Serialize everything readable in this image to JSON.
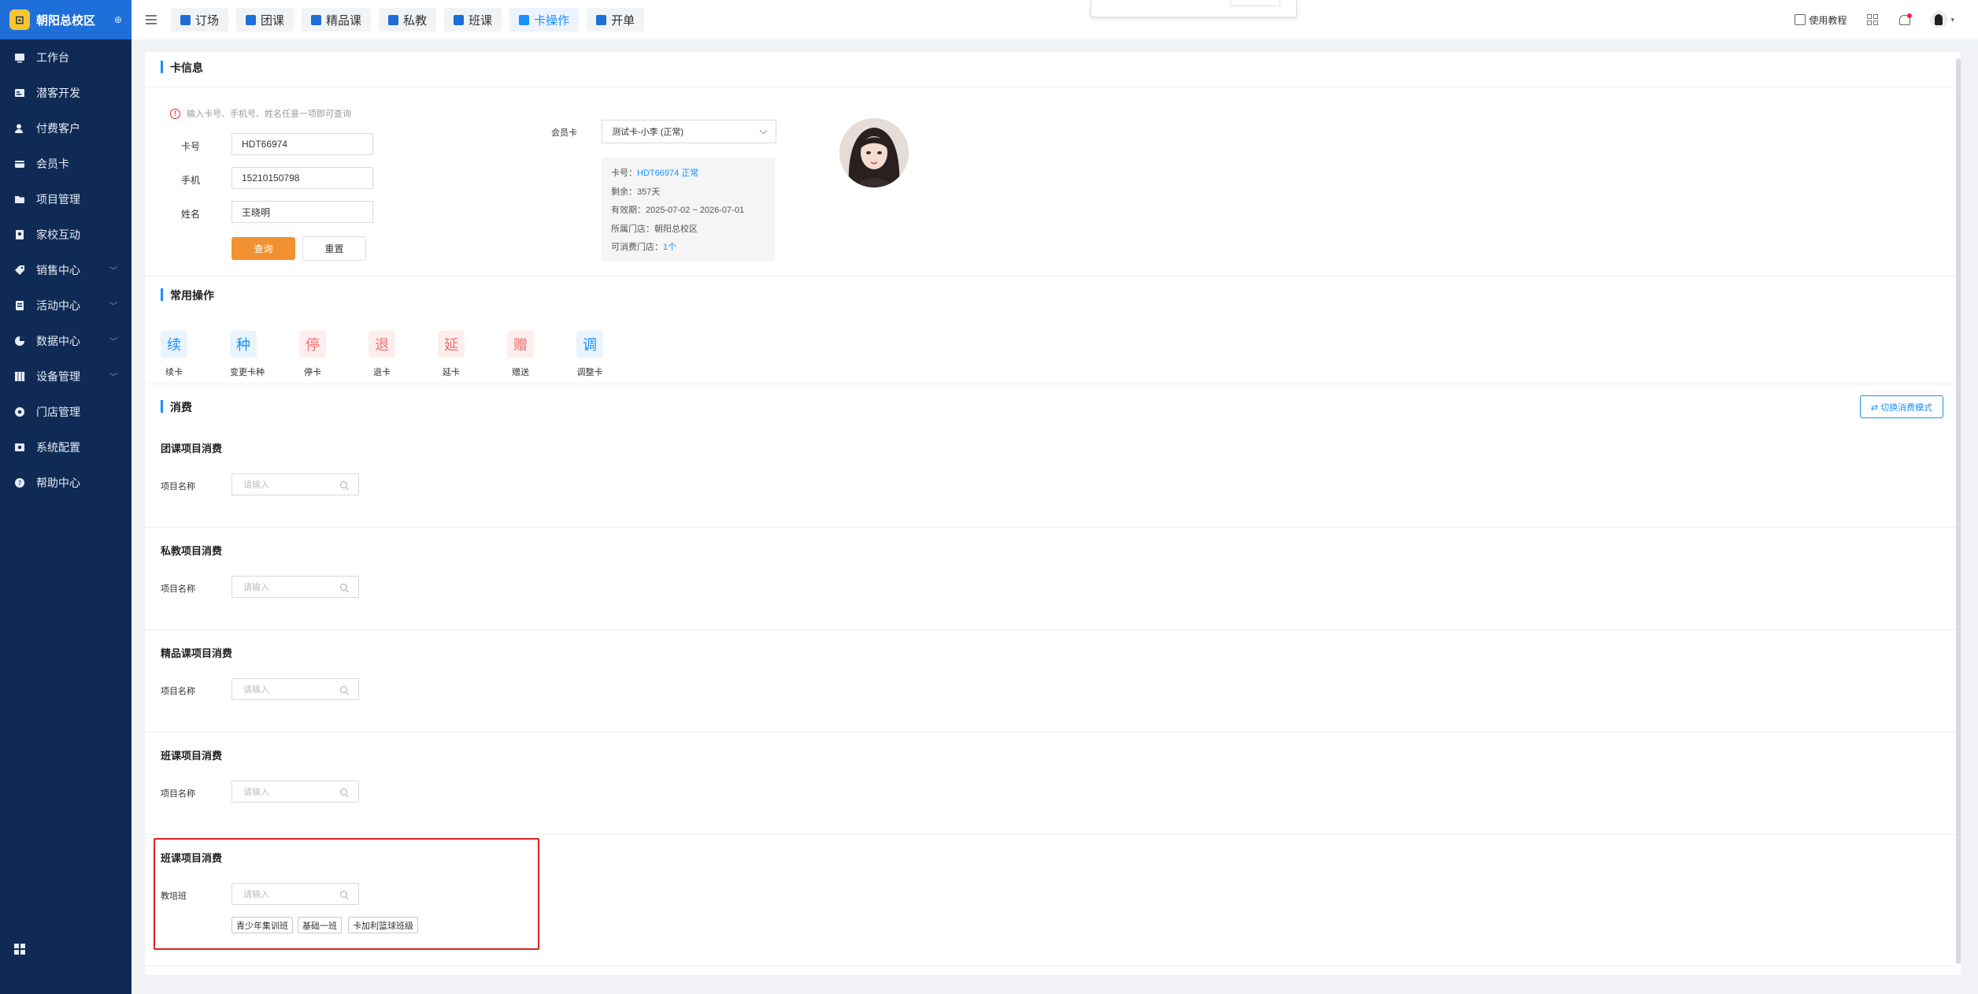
{
  "sidebar": {
    "brand": "朝阳总校区",
    "brand_icon": "school-logo-icon",
    "items": [
      {
        "label": "工作台",
        "icon": "workbench-icon"
      },
      {
        "label": "潜客开发",
        "icon": "prospect-icon"
      },
      {
        "label": "付费客户",
        "icon": "customer-icon"
      },
      {
        "label": "会员卡",
        "icon": "card-icon"
      },
      {
        "label": "项目管理",
        "icon": "project-icon"
      },
      {
        "label": "家校互动",
        "icon": "interaction-icon"
      },
      {
        "label": "销售中心",
        "icon": "tag-icon",
        "expandable": true
      },
      {
        "label": "活动中心",
        "icon": "activity-icon",
        "expandable": true
      },
      {
        "label": "数据中心",
        "icon": "chart-icon",
        "expandable": true
      },
      {
        "label": "设备管理",
        "icon": "device-icon",
        "expandable": true
      },
      {
        "label": "门店管理",
        "icon": "store-icon"
      },
      {
        "label": "系统配置",
        "icon": "settings-icon"
      },
      {
        "label": "帮助中心",
        "icon": "help-icon"
      }
    ]
  },
  "topnav": {
    "tabs": [
      {
        "label": "订场",
        "active": false
      },
      {
        "label": "团课",
        "active": false
      },
      {
        "label": "精品课",
        "active": false
      },
      {
        "label": "私教",
        "active": false
      },
      {
        "label": "班课",
        "active": false
      },
      {
        "label": "卡操作",
        "active": true
      },
      {
        "label": "开单",
        "active": false
      }
    ],
    "tutorial": "使用教程"
  },
  "card_info": {
    "title": "卡信息",
    "hint": "输入卡号、手机号、姓名任意一项即可查询",
    "card_no_label": "卡号",
    "card_no_value": "HDT66974",
    "phone_label": "手机",
    "phone_value": "15210150798",
    "name_label": "姓名",
    "name_value": "王晓明",
    "query_button": "查询",
    "reset_button": "重置",
    "member_card_label": "会员卡",
    "member_card_selected": "测试卡-小李 (正常)",
    "details": {
      "card_no_prefix": "卡号：",
      "card_no": "HDT66974",
      "status": "正常",
      "remaining": "剩余：357天",
      "validity": "有效期：2025-07-02 ~ 2026-07-01",
      "store": "所属门店：朝阳总校区",
      "usable_stores_prefix": "可消费门店：",
      "usable_stores": "1个"
    }
  },
  "common_ops": {
    "title": "常用操作",
    "items": [
      {
        "glyph": "续",
        "label": "续卡",
        "tone": "blue"
      },
      {
        "glyph": "种",
        "label": "变更卡种",
        "tone": "blue"
      },
      {
        "glyph": "停",
        "label": "停卡",
        "tone": "red"
      },
      {
        "glyph": "退",
        "label": "退卡",
        "tone": "red"
      },
      {
        "glyph": "延",
        "label": "延卡",
        "tone": "red"
      },
      {
        "glyph": "赠",
        "label": "赠送",
        "tone": "red"
      },
      {
        "glyph": "调",
        "label": "调整卡",
        "tone": "blue"
      }
    ]
  },
  "consume": {
    "title": "消费",
    "switch_button": "⇄ 切换消费模式",
    "sections": [
      {
        "title": "团课项目消费",
        "field_label": "项目名称",
        "placeholder": "请输入"
      },
      {
        "title": "私教项目消费",
        "field_label": "项目名称",
        "placeholder": "请输入"
      },
      {
        "title": "精品课项目消费",
        "field_label": "项目名称",
        "placeholder": "请输入"
      },
      {
        "title": "班课项目消费",
        "field_label": "项目名称",
        "placeholder": "请输入"
      },
      {
        "title": "班课项目消费",
        "field_label": "教培班",
        "placeholder": "请输入"
      }
    ],
    "class_tags": [
      "青少年集训班",
      "基础一班",
      "卡加利篮球班级"
    ]
  },
  "colors": {
    "sidebar_bg": "#0f2b55",
    "brand_bg": "#1e6fd9",
    "accent": "#1890ff",
    "query_button": "#f29131",
    "highlight": "#e02020"
  }
}
